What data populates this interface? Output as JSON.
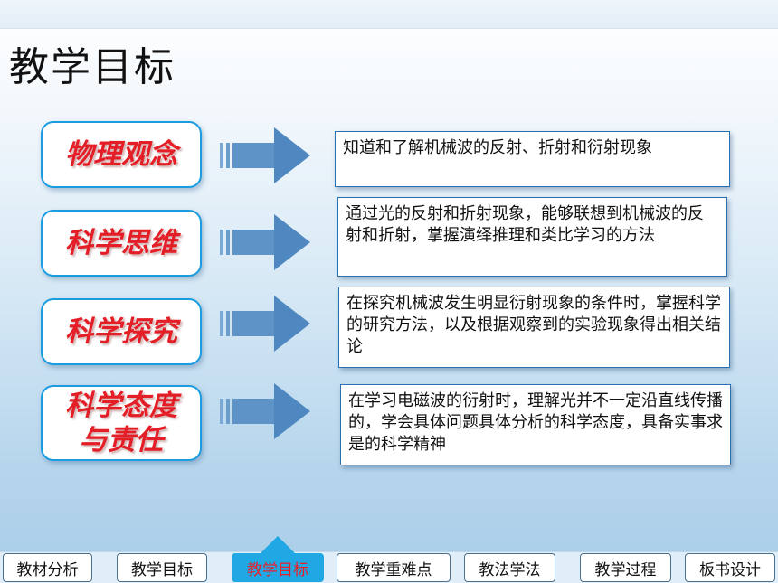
{
  "title": "教学目标",
  "objectives": [
    {
      "category": "物理观念",
      "description": "知道和了解机械波的反射、折射和衍射现象"
    },
    {
      "category": "科学思维",
      "description": "通过光的反射和折射现象，能够联想到机械波的反射和折射，掌握演绎推理和类比学习的方法"
    },
    {
      "category": "科学探究",
      "description": "在探究机械波发生明显衍射现象的条件时，掌握科学的研究方法，以及根据观察到的实验现象得出相关结论"
    },
    {
      "category": "科学态度\n与责任",
      "description": "在学习电磁波的衍射时，理解光并不一定沿直线传播的，学会具体问题具体分析的科学态度，具备实事求是的科学精神"
    }
  ],
  "nav": {
    "items": [
      "教材分析",
      "教学目标",
      "教学目标",
      "教学重难点",
      "教法学法",
      "教学过程",
      "板书设计"
    ],
    "active_index": 2
  },
  "colors": {
    "category_text": "#e41e26",
    "category_border": "#1a9de0",
    "active_nav": "#1fa8e3"
  }
}
